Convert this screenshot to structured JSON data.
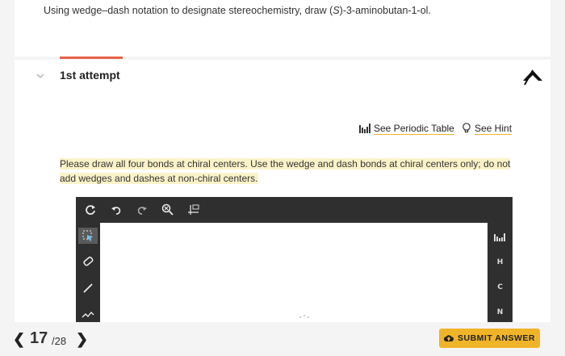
{
  "question": {
    "prefix": "Using wedge–dash notation to designate stereochemistry, draw (",
    "stereo": "S",
    "suffix": ")-3-aminobutan-1-ol."
  },
  "attempt": {
    "title": "1st attempt"
  },
  "links": {
    "periodic_table": "See Periodic Table",
    "hint": "See Hint"
  },
  "instruction": "Please draw all four bonds at chiral centers. Use the wedge and dash bonds at chiral centers only; do not add wedges and dashes at non-chiral centers.",
  "editor": {
    "toolbar": [
      "reset-icon",
      "undo-icon",
      "redo-icon",
      "zoom-icon",
      "2d-template-icon"
    ],
    "left_tools": [
      "selection-icon",
      "eraser-icon",
      "bond-icon",
      "chain-icon"
    ],
    "elements": [
      "periodic-icon",
      "H",
      "C",
      "N"
    ]
  },
  "pager": {
    "current": "17",
    "total": "/28"
  },
  "submit_label": "SUBMIT ANSWER",
  "colors": {
    "accent": "#f0b429",
    "underline": "#e8634a",
    "editor_bg": "#2f2f2f"
  }
}
